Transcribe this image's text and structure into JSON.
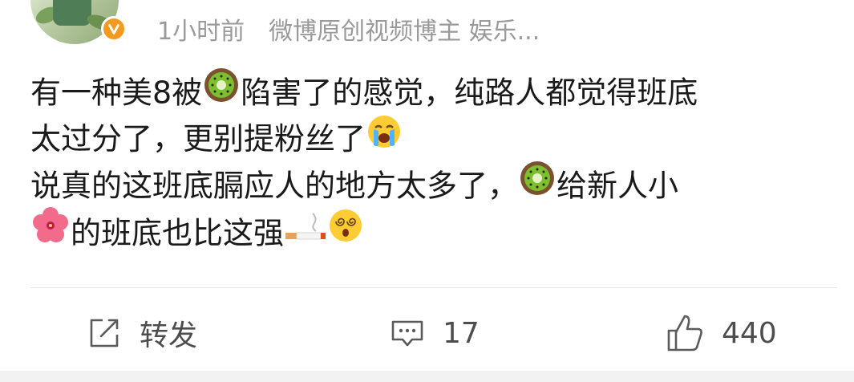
{
  "post": {
    "time": "1小时前",
    "source": "微博原创视频博主 娱乐...",
    "lines": [
      {
        "before": "有一种美8被",
        "after": "陷害了的感觉，纯路人都觉得班底"
      },
      {
        "before": "太过分了，更别提粉丝了",
        "after": ""
      },
      {
        "before": "说真的这班底膈应人的地方太多了，",
        "after": "给新人小"
      },
      {
        "before": "",
        "after": "的班底也比这强"
      }
    ],
    "emoji_names": [
      "kiwi-emoji",
      "crying-emoji",
      "kiwi-emoji",
      "hibiscus-emoji",
      "cigarette-emoji",
      "dizzy-face-emoji"
    ]
  },
  "actions": {
    "repost_label": "转发",
    "comment_count": "17",
    "like_count": "440"
  },
  "colors": {
    "meta_text": "#9a9a9a",
    "body_text": "#1a1a1a",
    "action_text": "#4d4d4d",
    "verified_badge": "#f39a1f"
  }
}
